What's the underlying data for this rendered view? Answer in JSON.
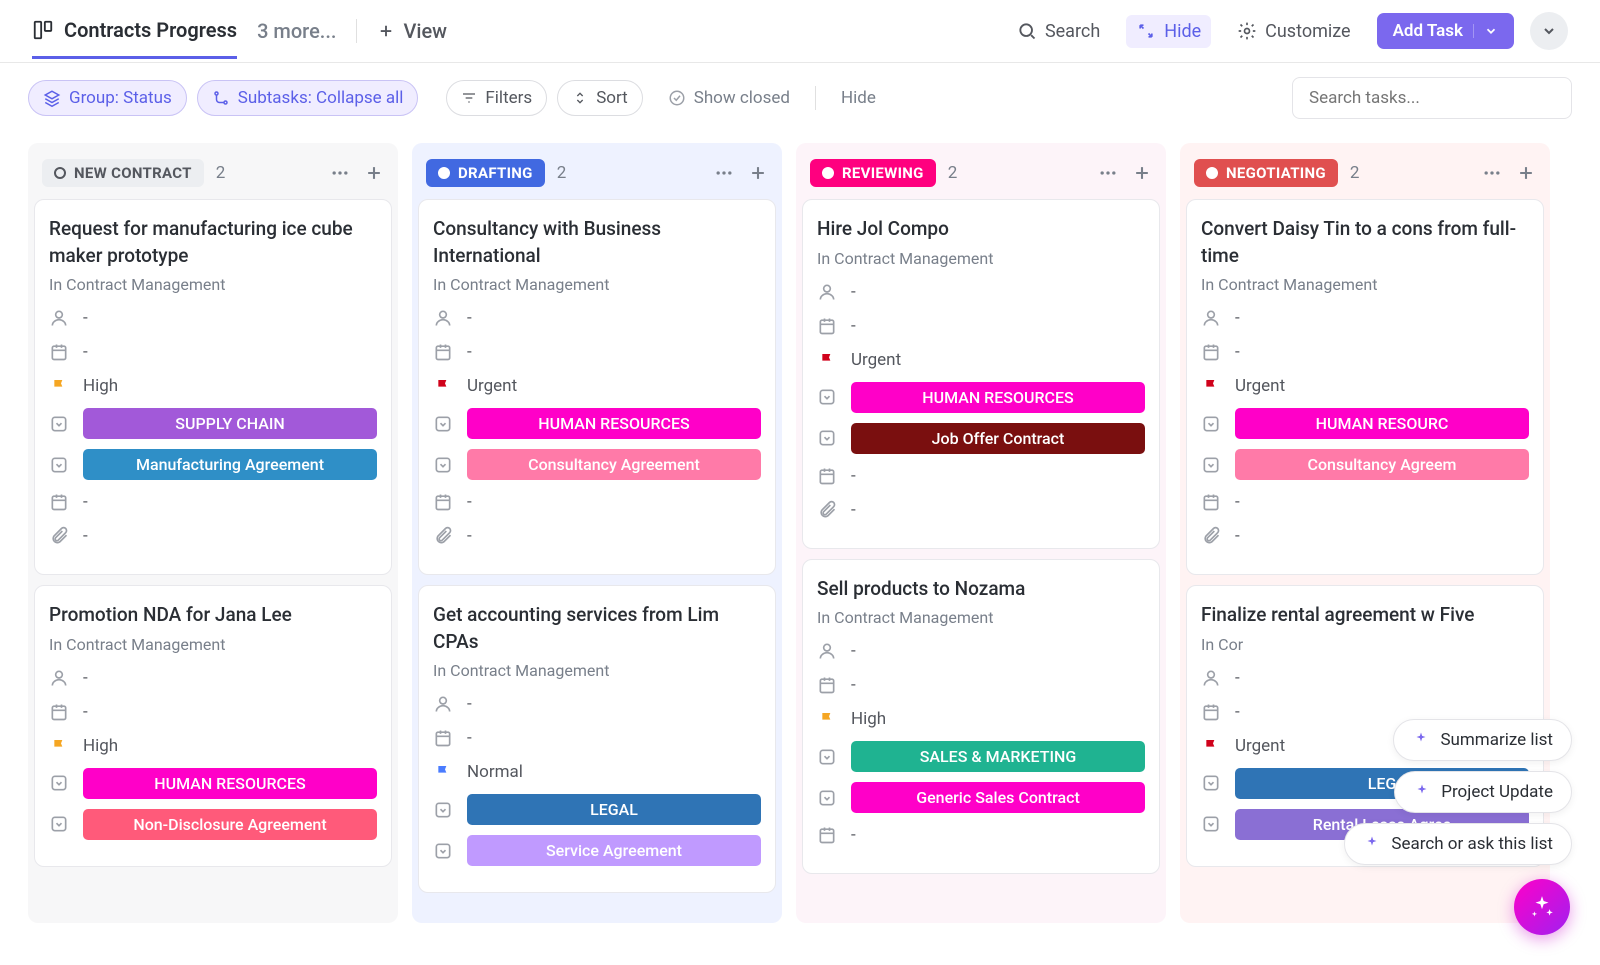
{
  "header": {
    "board_title": "Contracts Progress",
    "more_views": "3 more...",
    "add_view": "View",
    "search": "Search",
    "hide": "Hide",
    "customize": "Customize",
    "add_task": "Add Task"
  },
  "toolbar": {
    "group": "Group: Status",
    "subtasks": "Subtasks: Collapse all",
    "filters": "Filters",
    "sort": "Sort",
    "show_closed": "Show closed",
    "hide": "Hide",
    "search_placeholder": "Search tasks..."
  },
  "columns": [
    {
      "id": "new",
      "label": "NEW CONTRACT",
      "count": "2",
      "style": "gray",
      "cards": [
        {
          "title": "Request for manufacturing ice cube maker prototype",
          "sub": "In Contract Management",
          "assignee": "-",
          "date1": "-",
          "priority": "High",
          "priority_color": "#f5a623",
          "tags": [
            {
              "text": "SUPPLY CHAIN",
              "bg": "#a259d9"
            },
            {
              "text": "Manufacturing Agreement",
              "bg": "#2f8fc7"
            }
          ],
          "date2": "-",
          "attach": "-"
        },
        {
          "title": "Promotion NDA for Jana Lee",
          "sub": "In Contract Management",
          "assignee": "-",
          "date1": "-",
          "priority": "High",
          "priority_color": "#f5a623",
          "tags": [
            {
              "text": "HUMAN RESOURCES",
              "bg": "#ff00c8"
            },
            {
              "text": "Non-Disclosure Agreement",
              "bg": "#ff5a7a"
            }
          ]
        }
      ]
    },
    {
      "id": "drafting",
      "label": "DRAFTING",
      "count": "2",
      "style": "blue",
      "cards": [
        {
          "title": "Consultancy with Business International",
          "sub": "In Contract Management",
          "assignee": "-",
          "date1": "-",
          "priority": "Urgent",
          "priority_color": "#d0021b",
          "tags": [
            {
              "text": "HUMAN RESOURCES",
              "bg": "#ff00c8"
            },
            {
              "text": "Consultancy Agreement",
              "bg": "#ff7aa8"
            }
          ],
          "date2": "-",
          "attach": "-"
        },
        {
          "title": "Get accounting services from Lim CPAs",
          "sub": "In Contract Management",
          "assignee": "-",
          "date1": "-",
          "priority": "Normal",
          "priority_color": "#4a7cff",
          "tags": [
            {
              "text": "LEGAL",
              "bg": "#2f74b5"
            },
            {
              "text": "Service Agreement",
              "bg": "#c09aff"
            }
          ]
        }
      ]
    },
    {
      "id": "reviewing",
      "label": "REVIEWING",
      "count": "2",
      "style": "pink",
      "cards": [
        {
          "title": "Hire Jol Compo",
          "sub": "In Contract Management",
          "assignee": "-",
          "date1": "-",
          "priority": "Urgent",
          "priority_color": "#d0021b",
          "tags": [
            {
              "text": "HUMAN RESOURCES",
              "bg": "#ff00c8"
            },
            {
              "text": "Job Offer Contract",
              "bg": "#7a0f0f"
            }
          ],
          "date2": "-",
          "attach": "-"
        },
        {
          "title": "Sell products to Nozama",
          "sub": "In Contract Management",
          "assignee": "-",
          "date1": "-",
          "priority": "High",
          "priority_color": "#f5a623",
          "tags": [
            {
              "text": "SALES & MARKETING",
              "bg": "#1fb391"
            },
            {
              "text": "Generic Sales Contract",
              "bg": "#ff00c8"
            }
          ],
          "date2": "-"
        }
      ]
    },
    {
      "id": "negotiating",
      "label": "NEGOTIATING",
      "count": "2",
      "style": "red",
      "cards": [
        {
          "title": "Convert Daisy Tin to a cons from full-time",
          "sub": "In Contract Management",
          "assignee": "-",
          "date1": "-",
          "priority": "Urgent",
          "priority_color": "#d0021b",
          "tags": [
            {
              "text": "HUMAN RESOURC",
              "bg": "#ff00c8"
            },
            {
              "text": "Consultancy Agreem",
              "bg": "#ff7aa8"
            }
          ],
          "date2": "-",
          "attach": "-"
        },
        {
          "title": "Finalize rental agreement w Five",
          "sub": "In Cor",
          "assignee": "-",
          "date1": "-",
          "priority": "Urgent",
          "priority_color": "#d0021b",
          "tags": [
            {
              "text": "LEG",
              "bg": "#2f74b5"
            },
            {
              "text": "Rental Lease Agree",
              "bg": "#8a6fd4"
            }
          ]
        }
      ]
    }
  ],
  "ai": {
    "chips": [
      "Summarize list",
      "Project Update",
      "Search or ask this list"
    ]
  }
}
